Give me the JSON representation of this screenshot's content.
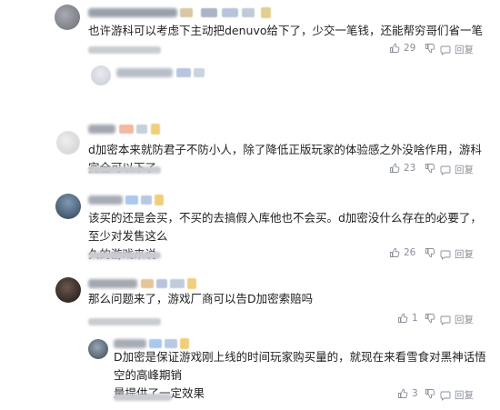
{
  "comments": [
    {
      "text_lines": [
        "也许游科可以考虑下主动把denuvo给下了，少交一笔钱，还能帮穷哥们省一笔"
      ],
      "likes": "29",
      "reply_label": "回复",
      "avatar_color": "#8a8d95"
    },
    {
      "text_lines": [
        "d加密本来就防君子不防小人，除了降低正版玩家的体验感之外没啥作用，游科完全可以下了"
      ],
      "likes": "23",
      "reply_label": "回复",
      "avatar_color": "#d7d7d9"
    },
    {
      "text_lines": [
        "该买的还是会买，不买的去搞假入库他也不会买。d加密没什么存在的必要了，至少对发售这么",
        "久的游戏来说"
      ],
      "likes": "26",
      "reply_label": "回复",
      "avatar_color": "#4f6a86"
    },
    {
      "text_lines": [
        "那么问题来了，游戏厂商可以告D加密索赔吗"
      ],
      "likes": "1",
      "reply_label": "回复",
      "avatar_color": "#3c2e2a"
    }
  ],
  "reply": {
    "text_lines": [
      "D加密是保证游戏刚上线的时间玩家购买量的，就现在来看雪食对黑神话悟空的高峰期销",
      "量提供了一定效果"
    ],
    "likes": "3",
    "reply_label": "回复",
    "avatar_color": "#5b6775"
  },
  "colors": {
    "accent_blue": "#4a90e2",
    "gold": "#f3b73c",
    "meta_gray": "#8a8f99"
  }
}
